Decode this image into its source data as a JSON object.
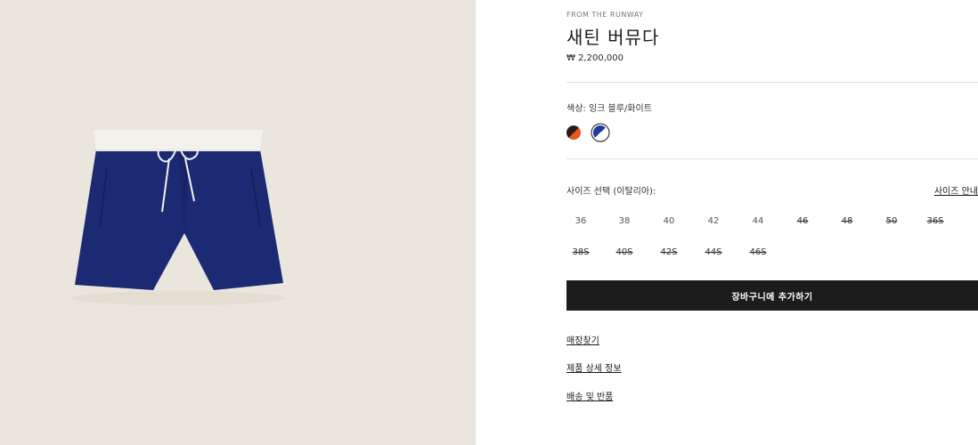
{
  "product": {
    "eyebrow": "FROM THE RUNWAY",
    "title": "새틴 버뮤다",
    "price": "₩ 2,200,000"
  },
  "color": {
    "label": "색상: 잉크 블루/화이트",
    "swatches": [
      {
        "name": "dark-orange",
        "colors": [
          "#2b1b14",
          "#e2571b"
        ],
        "selected": false
      },
      {
        "name": "ink-blue-white",
        "colors": [
          "#1f3b9c",
          "#ffffff"
        ],
        "selected": true
      }
    ]
  },
  "size": {
    "label": "사이즈 선택 (이탈리아):",
    "guide_link": "사이즈 안내",
    "options": [
      {
        "label": "36",
        "available": true
      },
      {
        "label": "38",
        "available": true
      },
      {
        "label": "40",
        "available": true
      },
      {
        "label": "42",
        "available": true
      },
      {
        "label": "44",
        "available": true
      },
      {
        "label": "46",
        "available": false
      },
      {
        "label": "48",
        "available": false
      },
      {
        "label": "50",
        "available": false
      },
      {
        "label": "36S",
        "available": false
      },
      {
        "label": "38S",
        "available": false
      },
      {
        "label": "40S",
        "available": false
      },
      {
        "label": "42S",
        "available": false
      },
      {
        "label": "44S",
        "available": false
      },
      {
        "label": "46S",
        "available": false
      }
    ]
  },
  "cta": {
    "add_to_cart": "장바구니에 추가하기"
  },
  "links": {
    "find_store": "매장찾기",
    "product_details": "제품 상세 정보",
    "shipping_returns": "배송 및 반품"
  }
}
